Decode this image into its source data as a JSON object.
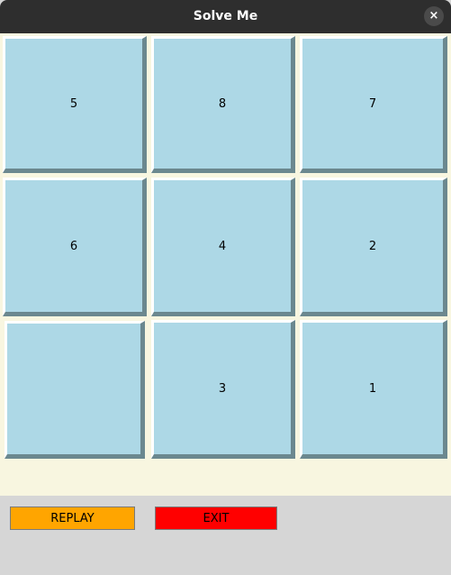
{
  "window": {
    "title": "Solve Me",
    "close_label": "×"
  },
  "board": {
    "tiles": [
      "5",
      "8",
      "7",
      "6",
      "4",
      "2",
      "",
      "3",
      "1"
    ],
    "tile_color": "#add8e6",
    "background_color": "#f8f6e0"
  },
  "controls": {
    "replay_label": "REPLAY",
    "replay_color": "#ffa500",
    "exit_label": "EXIT",
    "exit_color": "#ff0000"
  }
}
